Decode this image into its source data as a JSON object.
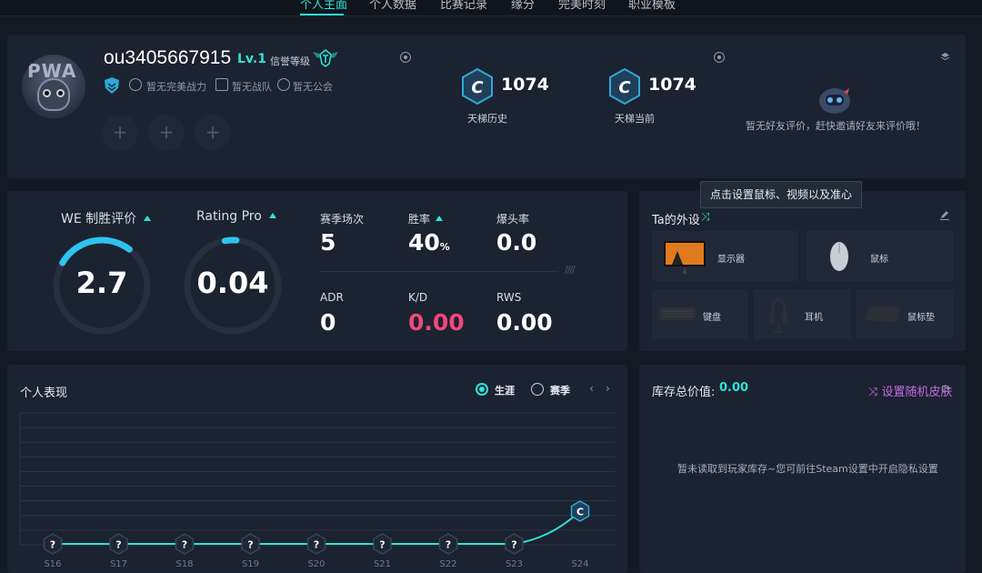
{
  "nav": {
    "tabs": [
      {
        "label": "个人主面",
        "active": true
      },
      {
        "label": "个人数据",
        "active": false
      },
      {
        "label": "比赛记录",
        "active": false
      },
      {
        "label": "缘分",
        "active": false
      },
      {
        "label": "完美时刻",
        "active": false
      },
      {
        "label": "职业模板",
        "active": false
      }
    ]
  },
  "profile": {
    "avatar_text": "PWA",
    "username": "ou3405667915",
    "level": "Lv.1",
    "credit_label": "信誉等级",
    "badges": [
      "暂无完美战力",
      "暂无战队",
      "暂无公会"
    ],
    "slot_symbol": "+",
    "ladder_history": {
      "value": "1074",
      "label": "天梯历史",
      "rank_letter": "C"
    },
    "ladder_current": {
      "value": "1074",
      "label": "天梯当前",
      "rank_letter": "C"
    },
    "friend_message": "暂无好友评价，赶快邀请好友来评价哦！"
  },
  "stats": {
    "we_rating": {
      "title": "WE 制胜评价",
      "value": "2.7",
      "fraction": 0.27
    },
    "rating_pro": {
      "title": "Rating Pro",
      "value": "0.04",
      "fraction": 0.04
    },
    "season_matches": {
      "label": "赛季场次",
      "value": "5"
    },
    "win_rate": {
      "label": "胜率",
      "value": "40",
      "unit": "%"
    },
    "headshot_rate": {
      "label": "爆头率",
      "value": "0.0"
    },
    "adr": {
      "label": "ADR",
      "value": "0"
    },
    "kd": {
      "label": "K/D",
      "value": "0.00"
    },
    "rws": {
      "label": "RWS",
      "value": "0.00"
    },
    "hatch": "////"
  },
  "tooltip": "点击设置鼠标、视频以及准心",
  "gear": {
    "title": "Ta的外设",
    "items": [
      "显示器",
      "鼠标",
      "键盘",
      "耳机",
      "鼠标垫"
    ]
  },
  "performance": {
    "title": "个人表现",
    "toggle": [
      {
        "label": "生涯",
        "selected": true
      },
      {
        "label": "赛季",
        "selected": false
      }
    ],
    "prev": "‹",
    "next": "›"
  },
  "chart_data": {
    "type": "line",
    "categories": [
      "S16",
      "S17",
      "S18",
      "S19",
      "S20",
      "S21",
      "S22",
      "S23",
      "S24"
    ],
    "series": [
      {
        "values": [
          null,
          null,
          null,
          null,
          null,
          null,
          null,
          null,
          1074
        ]
      }
    ],
    "point_badges": [
      "?",
      "?",
      "?",
      "?",
      "?",
      "?",
      "?",
      "?",
      "C"
    ],
    "grid": true
  },
  "inventory": {
    "title": "库存总价值:",
    "value": "0.00",
    "random_skin": "设置随机皮肤",
    "message": "暂未读取到玩家库存~您可前往Steam设置中开启隐私设置"
  },
  "colors": {
    "accent": "#2ee3d6",
    "danger": "#f0477a",
    "purple": "#c46ae6",
    "panel": "#1b2230"
  }
}
